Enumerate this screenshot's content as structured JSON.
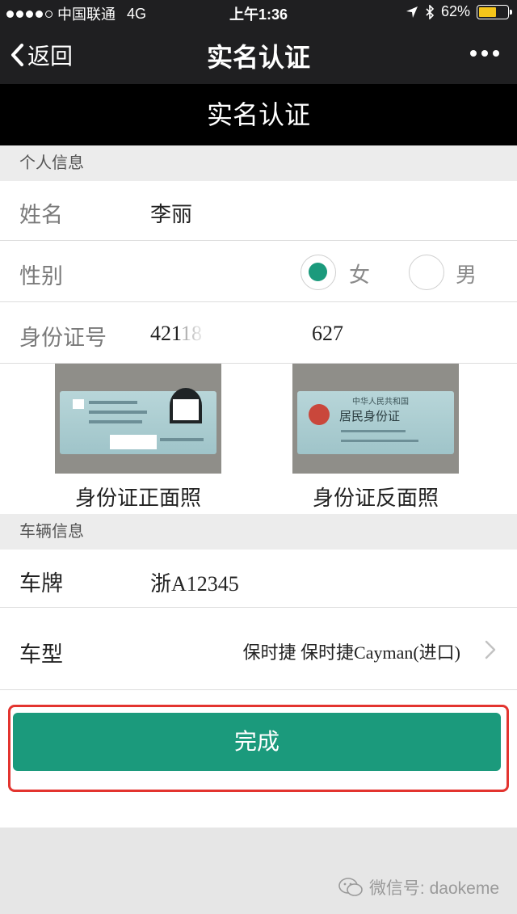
{
  "status_bar": {
    "carrier": "中国联通",
    "network": "4G",
    "time": "上午1:36",
    "battery": "62%",
    "battery_level": 0.62
  },
  "nav": {
    "back_label": "返回",
    "title": "实名认证"
  },
  "page_header": "实名认证",
  "personal_section": {
    "label": "个人信息",
    "name_label": "姓名",
    "name_value": "李丽",
    "gender_label": "性别",
    "gender_options": [
      "女",
      "男"
    ],
    "gender_selected": "女",
    "id_label": "身份证号",
    "id_prefix": "42118",
    "id_suffix": "627",
    "front_caption": "身份证正面照",
    "back_caption": "身份证反面照",
    "card_back_title": "中华人民共和国",
    "card_back_subtitle": "居民身份证"
  },
  "vehicle_section": {
    "label": "车辆信息",
    "plate_label": "车牌",
    "plate_value": "浙A12345",
    "model_label": "车型",
    "model_value": "保时捷 保时捷Cayman(进口)"
  },
  "done_button": "完成",
  "watermark": "微信号: daokeme",
  "colors": {
    "accent": "#1b9a7c",
    "highlight": "#e3342f",
    "battery": "#f5c51a"
  }
}
